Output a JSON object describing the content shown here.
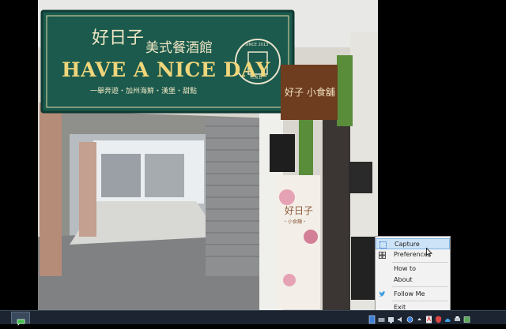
{
  "photo": {
    "main_sign": {
      "chinese_title": "好日子",
      "subtitle_chinese": "美式餐酒館",
      "english": "HAVE A NICE DAY",
      "tagline": "一舉奔遊・加州海鮮・漢堡・甜點",
      "badge_top": "SINCE 2013",
      "badge_bottom": "H.N.D"
    },
    "side_sign": {
      "text": "好子 小食舖"
    },
    "poster": {
      "title": "好日子",
      "sub": "・小食舖・"
    }
  },
  "menu": {
    "items": [
      {
        "label": "Capture",
        "icon": "capture-icon",
        "highlighted": true
      },
      {
        "label": "Preferences",
        "icon": "preferences-icon"
      },
      {
        "label": "How to",
        "icon": ""
      },
      {
        "label": "About",
        "icon": ""
      },
      {
        "label": "Follow Me",
        "icon": "twitter-bird-icon"
      },
      {
        "label": "Exit",
        "icon": ""
      }
    ]
  },
  "taskbar": {
    "app_icon": "chat-bubble-icon",
    "tray_icons": [
      "app-tray-icon",
      "keyboard-icon",
      "network-icon",
      "volume-icon",
      "clock-icon",
      "up-arrow-icon",
      "pdf-icon",
      "shield-icon",
      "cloud-upload-icon",
      "printer-icon",
      "show-desktop-icon"
    ],
    "accent": "#3f7fd6"
  }
}
